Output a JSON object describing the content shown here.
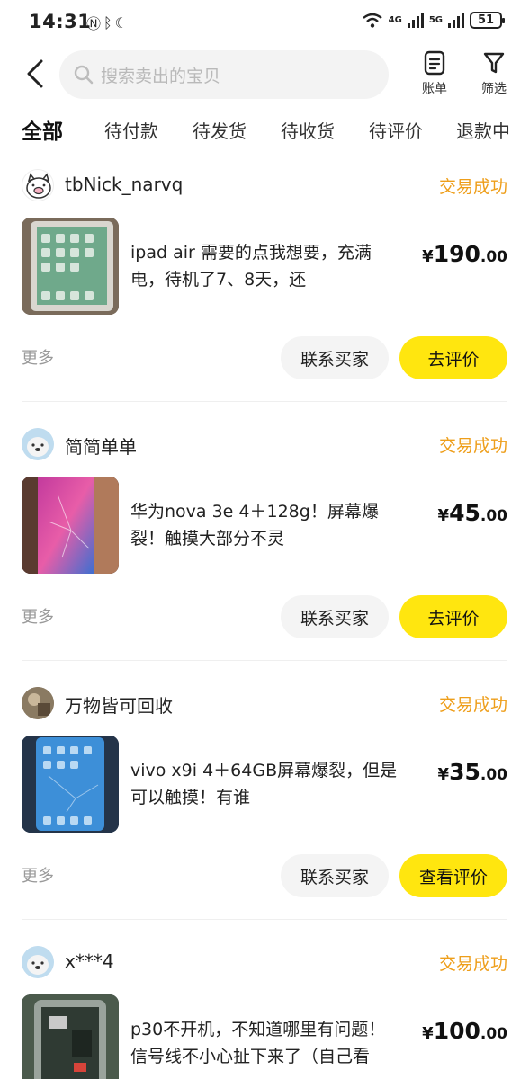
{
  "status_bar": {
    "time": "14:31",
    "net1": "4G",
    "net2": "5G",
    "battery": "51"
  },
  "header": {
    "search_placeholder": "搜索卖出的宝贝",
    "bill_label": "账单",
    "filter_label": "筛选"
  },
  "tabs": [
    "全部",
    "待付款",
    "待发货",
    "待收货",
    "待评价",
    "退款中"
  ],
  "orders": [
    {
      "seller": "tbNick_narvq",
      "status": "交易成功",
      "title": "ipad air 需要的点我想要，充满电，待机了7、8天，还",
      "price_int": "190",
      "price_dec": ".00",
      "more": "更多",
      "contact": "联系买家",
      "action": "去评价"
    },
    {
      "seller": "简简单单",
      "status": "交易成功",
      "title": "华为nova 3e 4＋128g！屏幕爆裂！触摸大部分不灵",
      "price_int": "45",
      "price_dec": ".00",
      "more": "更多",
      "contact": "联系买家",
      "action": "去评价"
    },
    {
      "seller": "万物皆可回收",
      "status": "交易成功",
      "title": "vivo x9i 4＋64GB屏幕爆裂，但是可以触摸！有谁",
      "price_int": "35",
      "price_dec": ".00",
      "more": "更多",
      "contact": "联系买家",
      "action": "查看评价"
    },
    {
      "seller": "x***4",
      "status": "交易成功",
      "title": "p30不开机，不知道哪里有问题！信号线不小心扯下来了（自己看",
      "price_int": "100",
      "price_dec": ".00"
    }
  ],
  "currency_symbol": "¥",
  "colors": {
    "accent_yellow": "#ffe60f",
    "status_orange": "#ee9e1a"
  }
}
